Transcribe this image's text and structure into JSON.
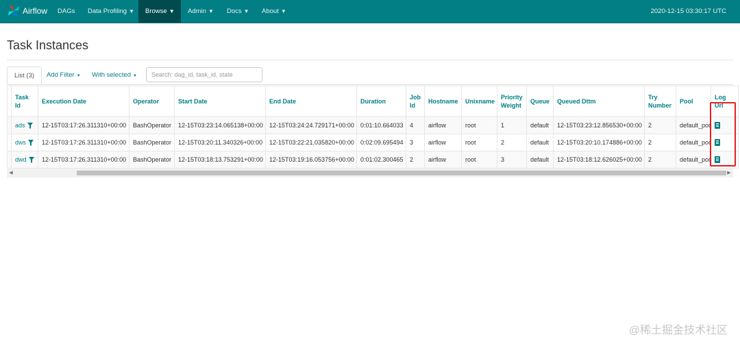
{
  "brand": {
    "name": "Airflow"
  },
  "nav": [
    {
      "label": "DAGs",
      "has_caret": false
    },
    {
      "label": "Data Profiling",
      "has_caret": true
    },
    {
      "label": "Browse",
      "has_caret": true,
      "active": true
    },
    {
      "label": "Admin",
      "has_caret": true
    },
    {
      "label": "Docs",
      "has_caret": true
    },
    {
      "label": "About",
      "has_caret": true
    }
  ],
  "clock": "2020-12-15 03:30:17 UTC",
  "page_title": "Task Instances",
  "tabs": {
    "list": "List (3)",
    "add_filter": "Add Filter",
    "with_selected": "With selected"
  },
  "search": {
    "placeholder": "Search: dag_id, task_id, state"
  },
  "table": {
    "headers": [
      "Task Id",
      "Execution Date",
      "Operator",
      "Start Date",
      "End Date",
      "Duration",
      "Job Id",
      "Hostname",
      "Unixname",
      "Priority Weight",
      "Queue",
      "Queued Dttm",
      "Try Number",
      "Pool",
      "Log Url"
    ],
    "rows": [
      [
        "ads",
        "12-15T03:17:26.311310+00:00",
        "BashOperator",
        "12-15T03:23:14.065138+00:00",
        "12-15T03:24:24.729171+00:00",
        "0:01:10.664033",
        "4",
        "airflow",
        "root",
        "1",
        "default",
        "12-15T03:23:12.856530+00:00",
        "2",
        "default_pool"
      ],
      [
        "dws",
        "12-15T03:17:26.311310+00:00",
        "BashOperator",
        "12-15T03:20:11.340326+00:00",
        "12-15T03:22:21.035820+00:00",
        "0:02:09.695494",
        "3",
        "airflow",
        "root",
        "2",
        "default",
        "12-15T03:20:10.174886+00:00",
        "2",
        "default_pool"
      ],
      [
        "dwd",
        "12-15T03:17:26.311310+00:00",
        "BashOperator",
        "12-15T03:18:13.753291+00:00",
        "12-15T03:19:16.053756+00:00",
        "0:01:02.300465",
        "2",
        "airflow",
        "root",
        "3",
        "default",
        "12-15T03:18:12.626025+00:00",
        "2",
        "default_pool"
      ]
    ]
  },
  "icons": {
    "filter": "filter-icon",
    "log": "log-file-icon",
    "caret": "chevron-down-icon"
  },
  "colors": {
    "navbar": "#017f85",
    "accent": "#017f85",
    "highlight": "#e02020"
  },
  "watermark": "@稀土掘金技术社区"
}
